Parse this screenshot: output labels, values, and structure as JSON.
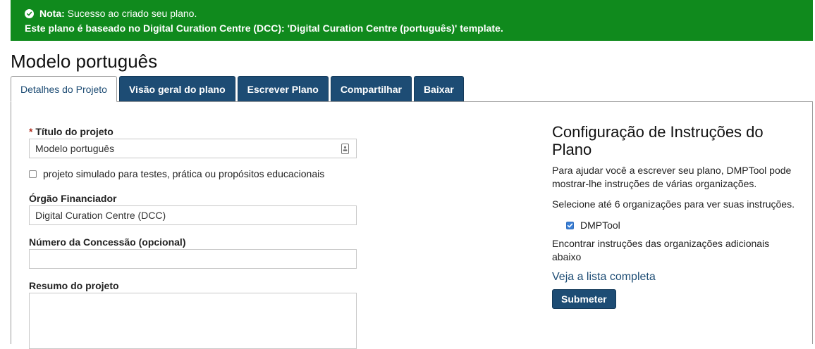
{
  "notice": {
    "prefix": "Nota:",
    "message": "Sucesso ao criado seu plano.",
    "template_line": "Este plano é baseado no Digital Curation Centre (DCC): 'Digital Curation Centre (português)' template."
  },
  "plan_title": "Modelo português",
  "tabs": [
    {
      "label": "Detalhes do Projeto",
      "active": true
    },
    {
      "label": "Visão geral do plano",
      "active": false
    },
    {
      "label": "Escrever Plano",
      "active": false
    },
    {
      "label": "Compartilhar",
      "active": false
    },
    {
      "label": "Baixar",
      "active": false
    }
  ],
  "form": {
    "required_mark": "*",
    "title_label": "Título do projeto",
    "title_value": "Modelo português",
    "mock_label": "projeto simulado para testes, prática ou propósitos educacionais",
    "mock_checked": false,
    "funder_label": "Órgão Financiador",
    "funder_value": "Digital Curation Centre (DCC)",
    "grant_label": "Número da Concessão (opcional)",
    "grant_value": "",
    "abstract_label": "Resumo do projeto",
    "abstract_value": ""
  },
  "guidance": {
    "heading": "Configuração de Instruções do Plano",
    "intro": "Para ajudar você a escrever seu plano, DMPTool pode mostrar-lhe instruções de várias organizações.",
    "select_hint": "Selecione até 6 organizações para ver suas instruções.",
    "orgs": [
      {
        "label": "DMPTool",
        "checked": true
      }
    ],
    "more_hint": "Encontrar instruções das organizações adicionais abaixo",
    "full_list_link": "Veja a lista completa",
    "submit_label": "Submeter"
  },
  "colors": {
    "notice_bg": "#108a1d",
    "tab_bg": "#1d4c74",
    "checkbox_checked": "#3a7fd6",
    "required": "#b03020"
  }
}
